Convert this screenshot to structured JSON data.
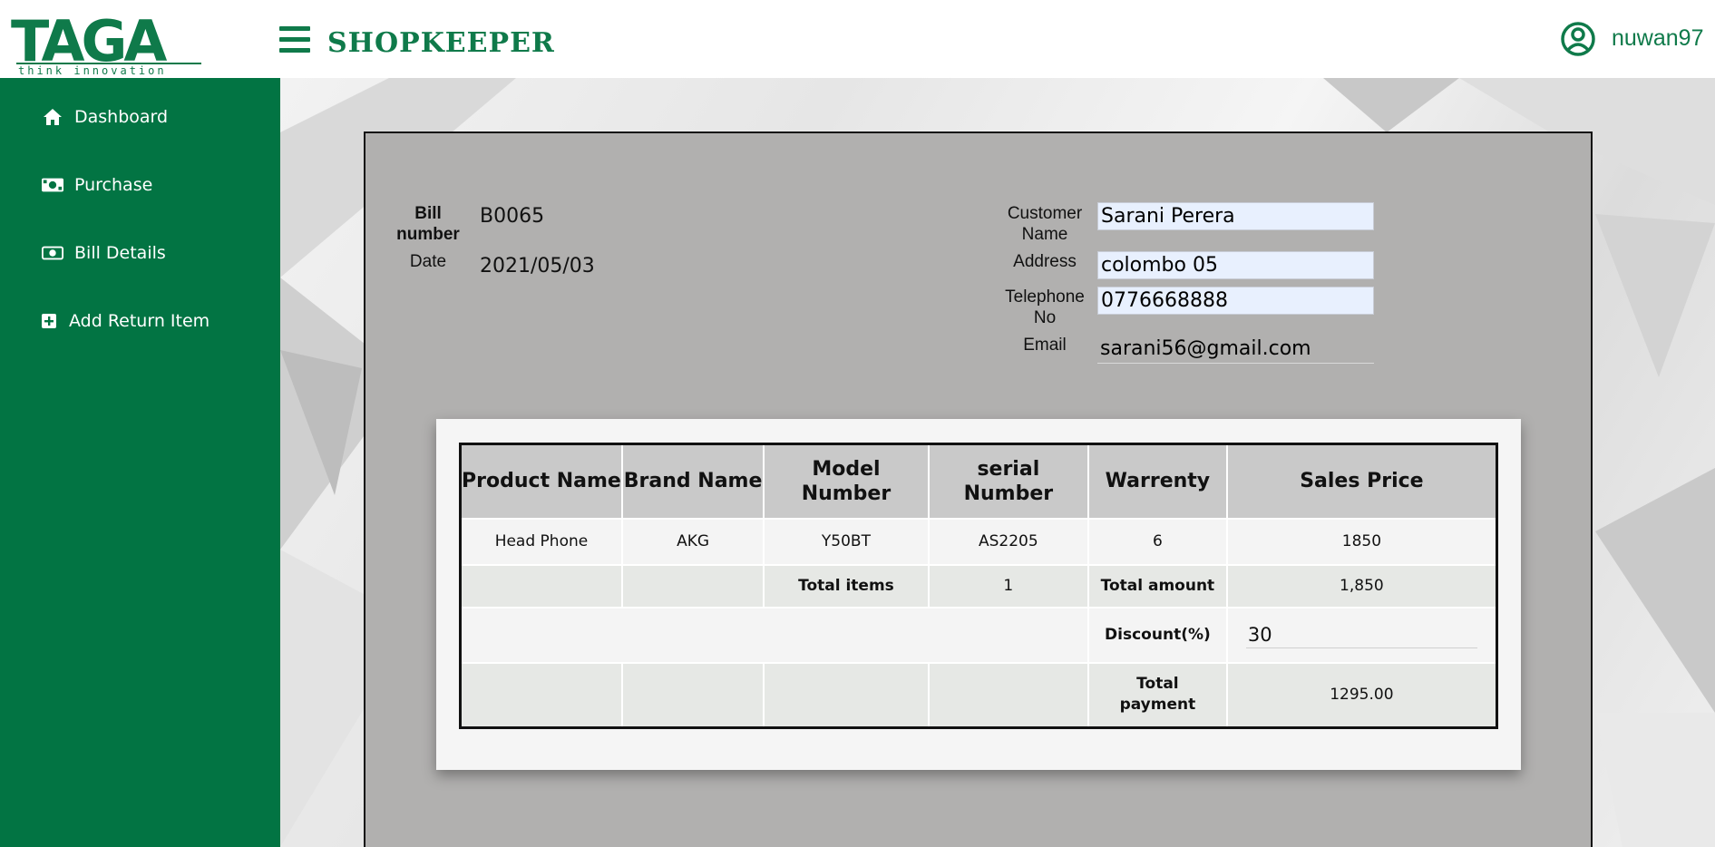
{
  "header": {
    "logo_text": "TAGA",
    "logo_tagline": "think innovation",
    "app_title": "SHOPKEEPER",
    "username": "nuwan97"
  },
  "sidebar": {
    "items": [
      {
        "label": "Dashboard",
        "icon": "home-icon"
      },
      {
        "label": "Purchase",
        "icon": "money-bill-icon"
      },
      {
        "label": "Bill Details",
        "icon": "money-bill-alt-icon"
      },
      {
        "label": "Add Return Item",
        "icon": "plus-square-icon"
      }
    ]
  },
  "bill": {
    "bill_number_label": "Bill number",
    "bill_number": "B0065",
    "date_label": "Date",
    "date": "2021/05/03"
  },
  "customer": {
    "name_label": "Customer Name",
    "name": "Sarani Perera",
    "address_label": "Address",
    "address": "colombo 05",
    "telephone_label": "Telephone No",
    "telephone": "0776668888",
    "email_label": "Email",
    "email": "sarani56@gmail.com"
  },
  "table": {
    "headers": [
      "Product Name",
      "Brand Name",
      "Model Number",
      "serial Number",
      "Warrenty",
      "Sales Price"
    ],
    "rows": [
      [
        "Head Phone",
        "AKG",
        "Y50BT",
        "AS2205",
        "6",
        "1850"
      ]
    ],
    "total_items_label": "Total items",
    "total_items": "1",
    "total_amount_label": "Total amount",
    "total_amount": "1,850",
    "discount_label": "Discount(%)",
    "discount": "30",
    "total_payment_label": "Total payment",
    "total_payment": "1295.00"
  },
  "colors": {
    "brand_green": "#027443",
    "panel_gray": "#b1b0af",
    "field_blue": "#e8f0fe"
  }
}
